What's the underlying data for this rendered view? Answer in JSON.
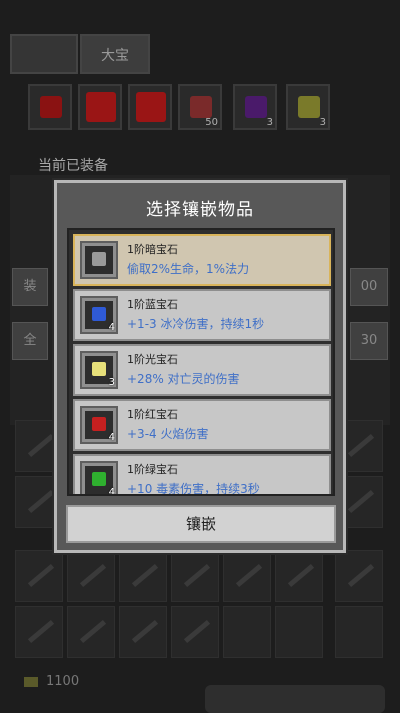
{
  "tabs": [
    "",
    "大宝"
  ],
  "inventory": [
    {
      "icon": "red-gem-icon",
      "count": ""
    },
    {
      "icon": "red-cube-icon",
      "count": ""
    },
    {
      "icon": "red-cube-icon",
      "count": ""
    },
    {
      "icon": "meat-icon",
      "count": "50"
    },
    {
      "icon": "purple-gem-icon",
      "count": "3"
    },
    {
      "icon": "yellow-gem-icon",
      "count": "3"
    }
  ],
  "equipped_label": "当前已装备",
  "side_buttons": {
    "left_a": "装",
    "left_b": "全",
    "right_a": "00",
    "right_b": "30"
  },
  "gold": "1100",
  "modal": {
    "title": "选择镶嵌物品",
    "items": [
      {
        "name": "1阶暗宝石",
        "desc": "偷取2%生命，1%法力",
        "count": "",
        "color": "#8a8a8a",
        "selected": true
      },
      {
        "name": "1阶蓝宝石",
        "desc": "+1-3 冰冷伤害，持续1秒",
        "count": "4",
        "color": "#2f5ad6",
        "selected": false
      },
      {
        "name": "1阶光宝石",
        "desc": "+28% 对亡灵的伤害",
        "count": "3",
        "color": "#e7e07a",
        "selected": false
      },
      {
        "name": "1阶红宝石",
        "desc": "+3-4 火焰伤害",
        "count": "4",
        "color": "#c52020",
        "selected": false
      },
      {
        "name": "1阶绿宝石",
        "desc": "+10 毒素伤害，持续3秒",
        "count": "4",
        "color": "#2fb02f",
        "selected": false
      }
    ],
    "confirm_label": "镶嵌"
  },
  "colors": {
    "accent": "#d9b45a",
    "desc_text": "#3f6fc7"
  }
}
